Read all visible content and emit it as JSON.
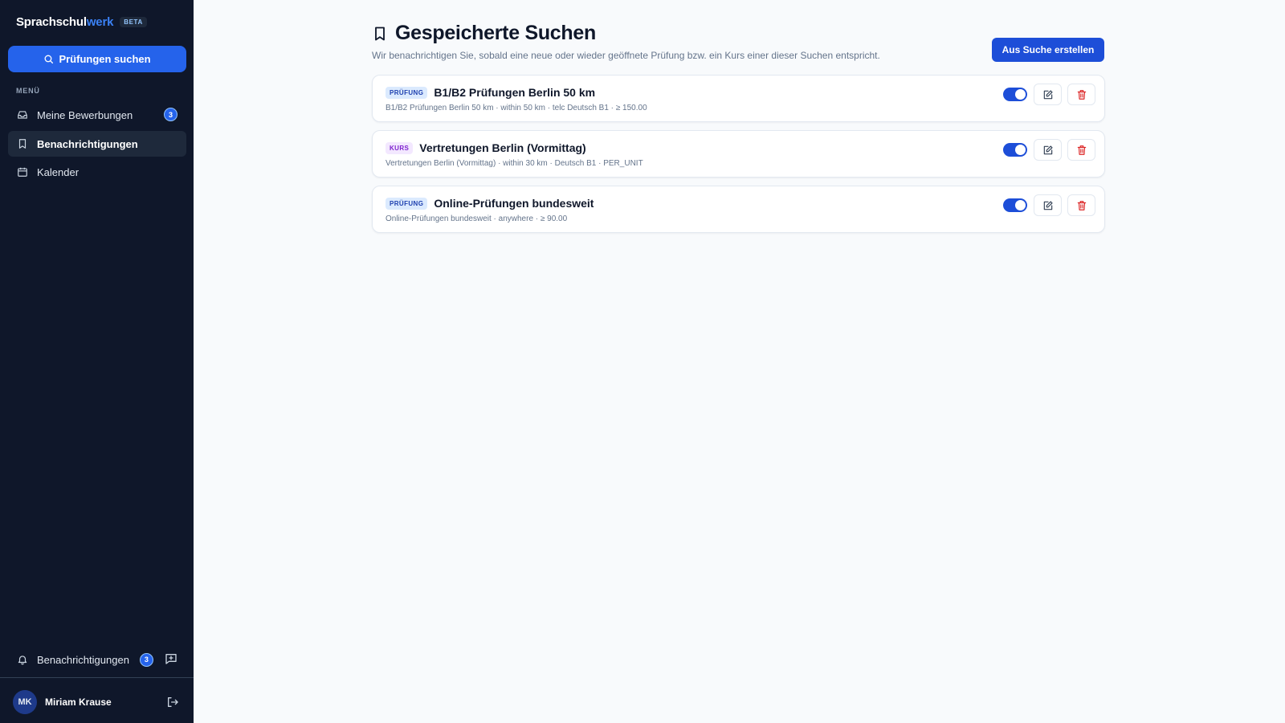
{
  "brand": {
    "name_part1": "Sprachschul",
    "name_part2": "werk",
    "badge": "BETA"
  },
  "sidebar": {
    "search_button": "Prüfungen suchen",
    "menu_label": "MENÜ",
    "items": [
      {
        "label": "Meine Bewerbungen",
        "icon": "inbox-icon",
        "badge": "3",
        "active": false
      },
      {
        "label": "Benachrichtigungen",
        "icon": "bookmark-icon",
        "active": true
      },
      {
        "label": "Kalender",
        "icon": "calendar-icon",
        "active": false
      }
    ],
    "notifications": {
      "label": "Benachrichtigungen",
      "badge": "3",
      "icon": "bell-icon"
    },
    "feedback_icon": "message-plus-icon",
    "user": {
      "initials": "MK",
      "name": "Miriam Krause"
    },
    "logout_icon": "logout-icon"
  },
  "main": {
    "title": "Gespeicherte Suchen",
    "title_icon": "bookmark-icon",
    "subtitle": "Wir benachrichtigen Sie, sobald eine neue oder wieder geöffnete Prüfung bzw. ein Kurs einer dieser Suchen entspricht.",
    "create_button": "Aus Suche erstellen",
    "searches": [
      {
        "type": "PRÜFUNG",
        "title": "B1/B2 Prüfungen Berlin 50 km",
        "meta": "B1/B2 Prüfungen Berlin 50 km · within 50 km · telc Deutsch B1 · ≥ 150.00",
        "enabled": true
      },
      {
        "type": "KURS",
        "title": "Vertretungen Berlin (Vormittag)",
        "meta": "Vertretungen Berlin (Vormittag) · within 30 km · Deutsch B1 · PER_UNIT",
        "enabled": true
      },
      {
        "type": "PRÜFUNG",
        "title": "Online-Prüfungen bundesweit",
        "meta": "Online-Prüfungen bundesweit · anywhere · ≥ 90.00",
        "enabled": true
      }
    ]
  },
  "colors": {
    "sidebar_bg": "#0f172a",
    "accent": "#2563eb",
    "danger": "#dc2626",
    "page_bg": "#f8fafc"
  }
}
